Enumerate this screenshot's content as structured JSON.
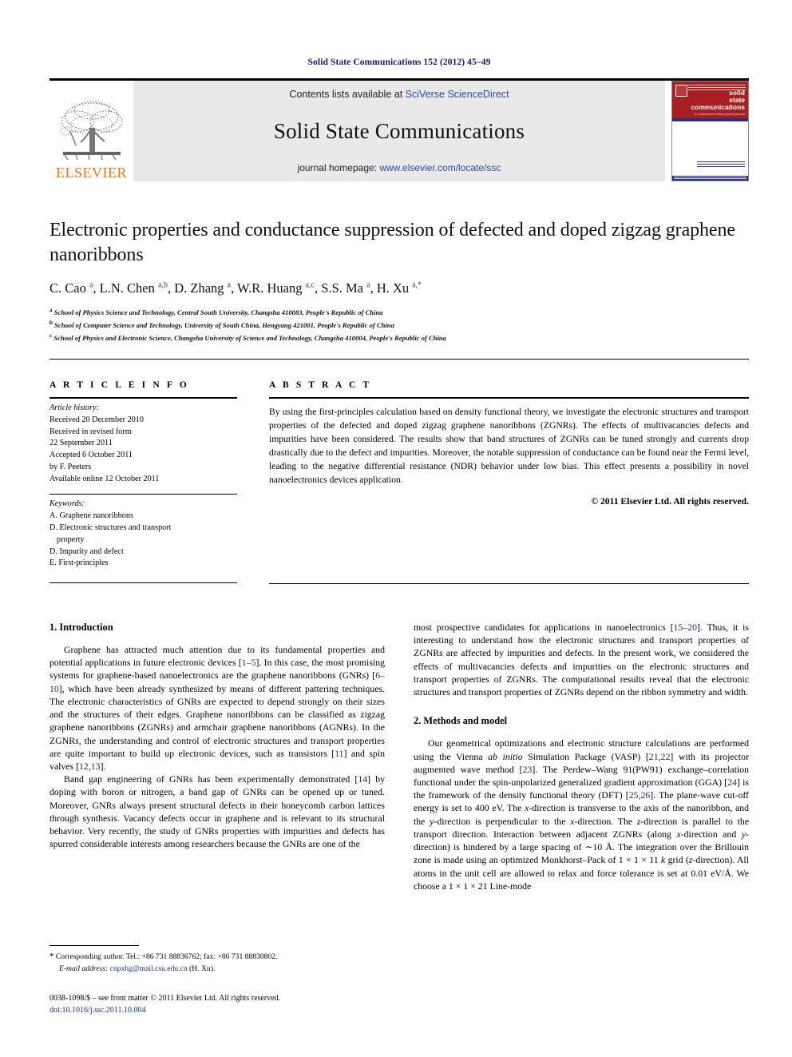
{
  "running_head": "Solid State Communications 152 (2012) 45–49",
  "masthead": {
    "publisher_logo_text": "ELSEVIER",
    "contents_prefix": "Contents lists available at ",
    "contents_link": "SciVerse ScienceDirect",
    "journal_title": "Solid State Communications",
    "homepage_prefix": "journal homepage: ",
    "homepage_link": "www.elsevier.com/locate/ssc",
    "cover": {
      "line1": "solid",
      "line2": "state",
      "line3": "communications",
      "tagline": "a condensed matter physics journal"
    },
    "link_color": "#2b4c9b"
  },
  "article": {
    "title": "Electronic properties and conductance suppression of defected and doped zigzag graphene nanoribbons",
    "authors_html": "C. Cao <sup>a</sup>, L.N. Chen <sup>a,b</sup>, D. Zhang <sup>a</sup>, W.R. Huang <sup>a,c</sup>, S.S. Ma <sup>a</sup>, H. Xu <sup>a,</sup><sup>*</sup>",
    "affiliations": [
      {
        "marker": "a",
        "text": "School of Physics Science and Technology, Central South University, Changsha 410083, People's Republic of China"
      },
      {
        "marker": "b",
        "text": "School of Computer Science and Technology, University of South China, Hengyang 421001, People's Republic of China"
      },
      {
        "marker": "c",
        "text": "School of Physics and Electronic Science, Changsha University of Science and Technology, Changsha 410004, People's Republic of China"
      }
    ]
  },
  "article_info": {
    "heading": "A R T I C L E   I N F O",
    "history_label": "Article history:",
    "history_lines": [
      "Received 20 December 2010",
      "Received in revised form",
      "22 September 2011",
      "Accepted 6 October 2011",
      "by F. Peeters",
      "Available online 12 October 2011"
    ],
    "keywords_label": "Keywords:",
    "keywords": [
      "A. Graphene nanoribbons",
      "D. Electronic structures and transport",
      "property",
      "D. Impurity and defect",
      "E. First-principles"
    ]
  },
  "abstract": {
    "heading": "A B S T R A C T",
    "text": "By using the first-principles calculation based on density functional theory, we investigate the electronic structures and transport properties of the defected and doped zigzag graphene nanoribbons (ZGNRs). The effects of multivacancies defects and impurities have been considered. The results show that band structures of ZGNRs can be tuned strongly and currents drop drastically due to the defect and impurities. Moreover, the notable suppression of conductance can be found near the Fermi level, leading to the negative differential resistance (NDR) behavior under low bias. This effect presents a possibility in novel nanoelectronics devices application.",
    "copyright": "© 2011 Elsevier Ltd. All rights reserved."
  },
  "sections": {
    "intro_heading": "1. Introduction",
    "intro_p1_html": "Graphene has attracted much attention due to its fundamental properties and potential applications in future electronic devices [<span class=\"ref\">1–5</span>]. In this case, the most promising systems for graphene-based nanoelectronics are the graphene nanoribbons (GNRs) [<span class=\"ref\">6–10</span>], which have been already synthesized by means of different pattering techniques. The electronic characteristics of GNRs are expected to depend strongly on their sizes and the structures of their edges. Graphene nanoribbons can be classified as zigzag graphene nanoribbons (ZGNRs) and armchair graphene nanoribbons (AGNRs). In the ZGNRs, the understanding and control of electronic structures and transport properties are quite important to build up electronic devices, such as transistors [<span class=\"ref\">11</span>] and spin valves [<span class=\"ref\">12,13</span>].",
    "intro_p2_html": "Band gap engineering of GNRs has been experimentally demonstrated [<span class=\"ref\">14</span>] by doping with boron or nitrogen, a band gap of GNRs can be opened up or tuned. Moreover, GNRs always present structural defects in their honeycomb carbon lattices through synthesis. Vacancy defects occur in graphene and is relevant to its structural behavior. Very recently, the study of GNRs properties with impurities and defects has spurred considerable interests among researchers because the GNRs are one of the",
    "intro_p2_cont_html": "most prospective candidates for applications in nanoelectronics [<span class=\"ref\">15–20</span>]. Thus, it is interesting to understand how the electronic structures and transport properties of ZGNRs are affected by impurities and defects. In the present work, we considered the effects of multivacancies defects and impurities on the electronic structures and transport properties of ZGNRs. The computational results reveal that the electronic structures and transport properties of ZGNRs depend on the ribbon symmetry and width.",
    "methods_heading": "2. Methods and model",
    "methods_p1_html": "Our geometrical optimizations and electronic structure calculations are performed using the Vienna <span class=\"it\">ab initio</span> Simulation Package (VASP) [<span class=\"ref\">21,22</span>] with its projector augmented wave method [<span class=\"ref\">23</span>]. The Perdew–Wang 91(PW91) exchange–correlation functional under the spin-unpolarized generalized gradient approximation (GGA) [<span class=\"ref\">24</span>] is the framework of the density functional theory (DFT) [<span class=\"ref\">25,26</span>]. The plane-wave cut-off energy is set to 400 eV. The <span class=\"it\">x</span>-direction is transverse to the axis of the nanoribbon, and the <span class=\"it\">y</span>-direction is perpendicular to the <span class=\"it\">x</span>-direction. The <span class=\"it\">z</span>-direction is parallel to the transport direction. Interaction between adjacent ZGNRs (along <span class=\"it\">x</span>-direction and <span class=\"it\">y</span>-direction) is hindered by a large spacing of ∼10 Å. The integration over the Brillouin zone is made using an optimized Monkhorst–Pack of 1 × 1 × 11 <span class=\"it\">k</span> grid (<span class=\"it\">z</span>-direction). All atoms in the unit cell are allowed to relax and force tolerance is set at 0.01 eV/Å. We choose a 1 × 1 × 21 Line-mode"
  },
  "footnote": {
    "star": "*",
    "corresponding_html": "Corresponding author. Tel.: +86 731 88836762; fax: +86 731 88830802.",
    "email_label": "E-mail address:",
    "email": "cnpxhg@mail.csu.edu.cn",
    "email_owner": "(H. Xu)."
  },
  "imprint": {
    "line1": "0038-1098/$ – see front matter © 2011 Elsevier Ltd. All rights reserved.",
    "doi": "doi:10.1016/j.ssc.2011.10.004"
  }
}
